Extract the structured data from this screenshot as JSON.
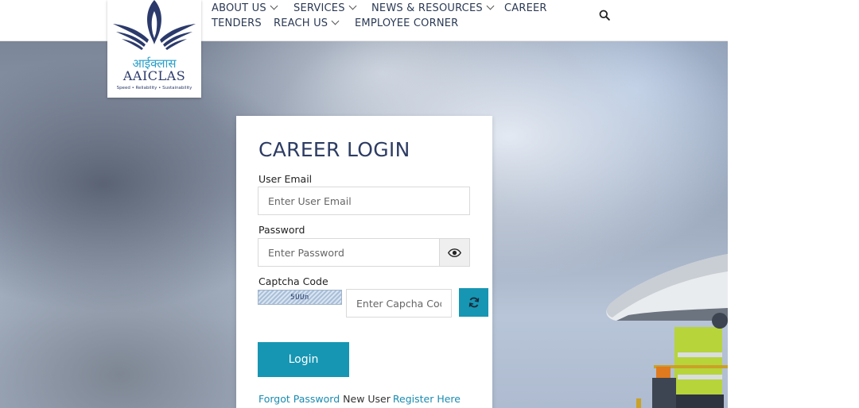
{
  "brand": {
    "hindi": "आईक्लास",
    "name": "AAICLAS",
    "tagline": "Speed • Reliability • Sustainability"
  },
  "nav": {
    "about": "ABOUT US",
    "services": "SERVICES",
    "news": "NEWS & RESOURCES",
    "career": "CAREER",
    "tenders": "TENDERS",
    "reach": "REACH US",
    "employee": "EMPLOYEE CORNER",
    "search_icon": "search-icon"
  },
  "login": {
    "title": "CAREER LOGIN",
    "email_label": "User Email",
    "email_placeholder": "Enter User Email",
    "password_label": "Password",
    "password_placeholder": "Enter Password",
    "captcha_label": "Captcha Code",
    "captcha_text": "5UUn",
    "captcha_placeholder": "Enter Capcha Code",
    "login_button": "Login",
    "forgot_password": "Forgot Password",
    "new_user": "New User",
    "register": "Register Here"
  },
  "colors": {
    "accent": "#1696b3",
    "title": "#2d3c63",
    "link": "#1a8bb0",
    "nav_text": "#2b3a55"
  }
}
